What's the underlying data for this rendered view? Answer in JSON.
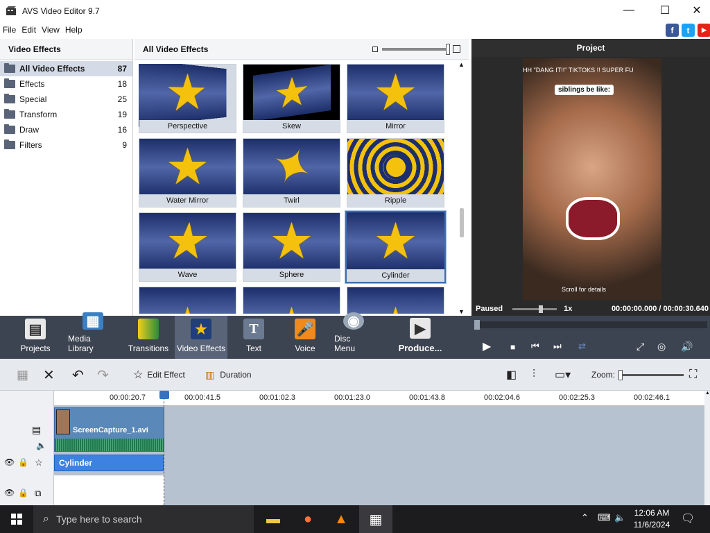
{
  "window": {
    "title": "AVS Video Editor 9.7",
    "minimize": "—",
    "maximize": "☐",
    "close": "✕"
  },
  "menu": [
    "File",
    "Edit",
    "View",
    "Help"
  ],
  "social": {
    "facebook": "f",
    "twitter": "t",
    "youtube": "▶",
    "facebook_color": "#3b5998",
    "twitter_color": "#1da1f2",
    "youtube_color": "#e62117"
  },
  "left_panel": {
    "title": "Video Effects",
    "categories": [
      {
        "name": "All Video Effects",
        "count": "87"
      },
      {
        "name": "Effects",
        "count": "18"
      },
      {
        "name": "Special",
        "count": "25"
      },
      {
        "name": "Transform",
        "count": "19"
      },
      {
        "name": "Draw",
        "count": "16"
      },
      {
        "name": "Filters",
        "count": "9"
      }
    ]
  },
  "grid_panel": {
    "title": "All Video Effects",
    "tiles": [
      "Perspective",
      "Skew",
      "Mirror",
      "Water Mirror",
      "Twirl",
      "Ripple",
      "Wave",
      "Sphere",
      "Cylinder"
    ],
    "selected": "Cylinder"
  },
  "project": {
    "title": "Project",
    "caption": "HH \"DANG IT!!\" TIKTOKS !! SUPER FU",
    "sticker": "siblings be like:",
    "bottom_text": "Scroll for details",
    "status": "Paused",
    "speed": "1x",
    "time": "00:00:00.000 / 00:00:30.640"
  },
  "toolbar": {
    "items": [
      "Projects",
      "Media Library",
      "Transitions",
      "Video Effects",
      "Text",
      "Voice",
      "Disc Menu",
      "Produce..."
    ],
    "active": "Video Effects"
  },
  "playback": {
    "play": "▶",
    "stop": "■",
    "prev": "⏮",
    "next": "⏭"
  },
  "timeline_toolbar": {
    "edit_effect": "Edit Effect",
    "duration": "Duration",
    "zoom": "Zoom:"
  },
  "ruler": [
    "00:00:20.7",
    "00:00:41.5",
    "00:01:02.3",
    "00:01:23.0",
    "00:01:43.8",
    "00:02:04.6",
    "00:02:25.3",
    "00:02:46.1"
  ],
  "timeline": {
    "video_clip": "ScreenCapture_1.avi",
    "effect_clip": "Cylinder"
  },
  "taskbar": {
    "search_placeholder": "Type here to search",
    "time": "12:06 AM",
    "date": "11/6/2024"
  }
}
